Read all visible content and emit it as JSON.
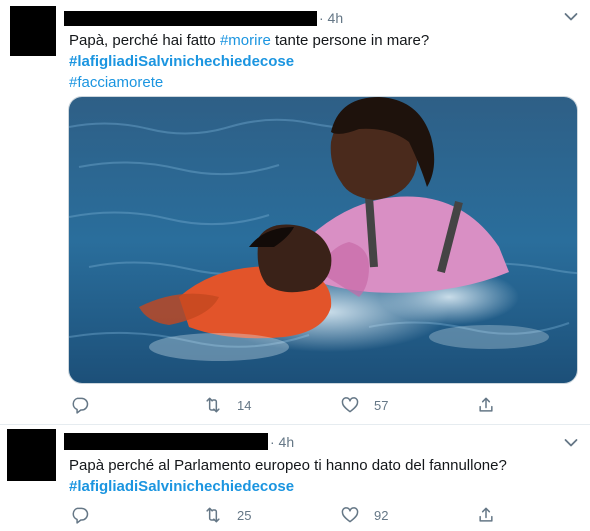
{
  "tweets": [
    {
      "time": "· 4h",
      "text_prefix": "Papà, perché hai fatto ",
      "text_hashtag": "#morire",
      "text_suffix": " tante persone in mare?",
      "hashtag_bold": "#lafigliadiSalvinichechiedecose",
      "hashtag_plain": "#facciamorete",
      "media_icon": "photo-rescue-at-sea",
      "actions": {
        "reply": "",
        "retweets": "14",
        "likes": "57"
      }
    },
    {
      "time": "· 4h",
      "text": "Papà perché al Parlamento europeo ti hanno dato del fannullone?",
      "hashtag_bold": "#lafigliadiSalvinichechiedecose",
      "actions": {
        "reply": "",
        "retweets": "25",
        "likes": "92"
      }
    }
  ],
  "colors": {
    "link": "#1b95e0",
    "secondary_text": "#657786",
    "border": "#e6ecf0",
    "redaction": "#000000"
  },
  "icons": [
    "chevron-down-icon",
    "reply-icon",
    "retweet-icon",
    "like-icon",
    "share-icon"
  ]
}
